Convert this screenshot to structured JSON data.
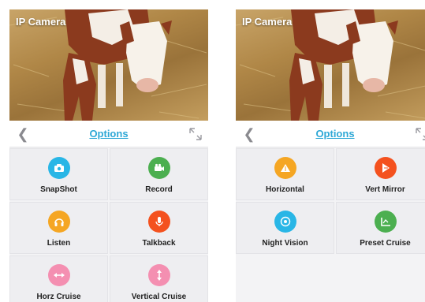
{
  "left": {
    "feed_title": "IP Camera",
    "options_title": "Options",
    "tiles": [
      {
        "label": "SnapShot",
        "icon": "camera-icon",
        "color": "#29b6e6"
      },
      {
        "label": "Record",
        "icon": "video-camera-icon",
        "color": "#4caf50"
      },
      {
        "label": "Listen",
        "icon": "headphones-icon",
        "color": "#f5a623"
      },
      {
        "label": "Talkback",
        "icon": "microphone-icon",
        "color": "#f4511e"
      },
      {
        "label": "Horz Cruise",
        "icon": "horizontal-arrows-icon",
        "color": "#f48fb1"
      },
      {
        "label": "Vertical Cruise",
        "icon": "vertical-arrows-icon",
        "color": "#f48fb1"
      }
    ]
  },
  "right": {
    "feed_title": "IP Camera",
    "options_title": "Options",
    "tiles": [
      {
        "label": "Horizontal",
        "icon": "horizontal-flip-icon",
        "color": "#f5a623"
      },
      {
        "label": "Vert Mirror",
        "icon": "vertical-mirror-icon",
        "color": "#f4511e"
      },
      {
        "label": "Night Vision",
        "icon": "night-vision-icon",
        "color": "#29b6e6"
      },
      {
        "label": "Preset Cruise",
        "icon": "preset-cruise-icon",
        "color": "#4caf50"
      }
    ]
  }
}
